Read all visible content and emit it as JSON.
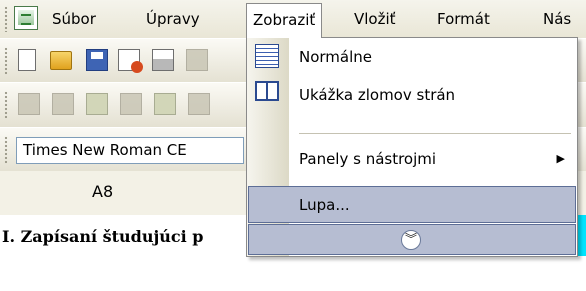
{
  "menubar": {
    "items": [
      {
        "label": "Súbor"
      },
      {
        "label": "Úpravy"
      },
      {
        "label": "Zobraziť"
      },
      {
        "label": "Vložiť"
      },
      {
        "label": "Formát"
      },
      {
        "label": "Nás"
      }
    ]
  },
  "formatting": {
    "font_name": "Times New Roman CE"
  },
  "formula_bar": {
    "name_box": "A8"
  },
  "sheet": {
    "cell_text": "I. Zapísaní študujúci p"
  },
  "view_menu": {
    "items": [
      {
        "label": "Normálne",
        "icon": "normal-view-icon"
      },
      {
        "label": "Ukážka zlomov strán",
        "icon": "page-break-preview-icon"
      },
      {
        "label": "Panely s nástrojmi",
        "submenu": true
      },
      {
        "label": "Lupa..."
      }
    ],
    "expand_icon": "double-chevron-down-icon"
  },
  "colors": {
    "menu_highlight": "#B6BDD2",
    "highlight_border": "#5D6E96",
    "cell_accent": "#00E5FF"
  }
}
